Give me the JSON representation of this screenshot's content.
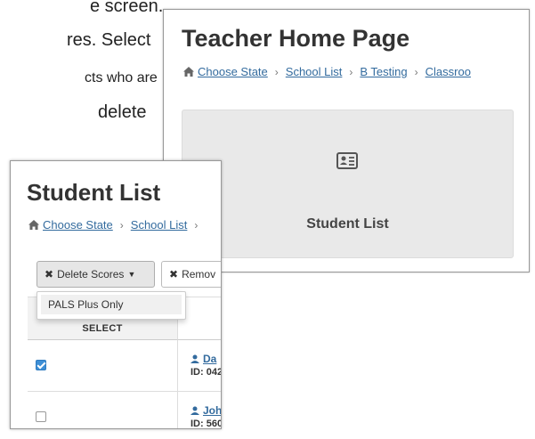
{
  "background_text": {
    "line1": "e screen.",
    "line2": "res. Select",
    "line3": "cts who are",
    "line4": "delete"
  },
  "teacher_home": {
    "title": "Teacher Home Page",
    "breadcrumb": [
      "Choose State",
      "School List",
      "B Testing",
      "Classroo"
    ],
    "card_label": "Student List"
  },
  "student_list": {
    "title": "Student List",
    "breadcrumb": [
      "Choose State",
      "School List"
    ],
    "delete_button_label": "Delete Scores",
    "remove_button_label": "Remov",
    "dropdown_item": "PALS Plus Only",
    "select_header": "SELECT",
    "rows": [
      {
        "checked": true,
        "name": "Da",
        "id": "ID: 042"
      },
      {
        "checked": false,
        "name": "Joh",
        "id": "ID: 560"
      }
    ]
  },
  "colors": {
    "link": "#336b9e",
    "checkbox_checked": "#3e8fd6",
    "card_bg": "#e9e9e9"
  }
}
